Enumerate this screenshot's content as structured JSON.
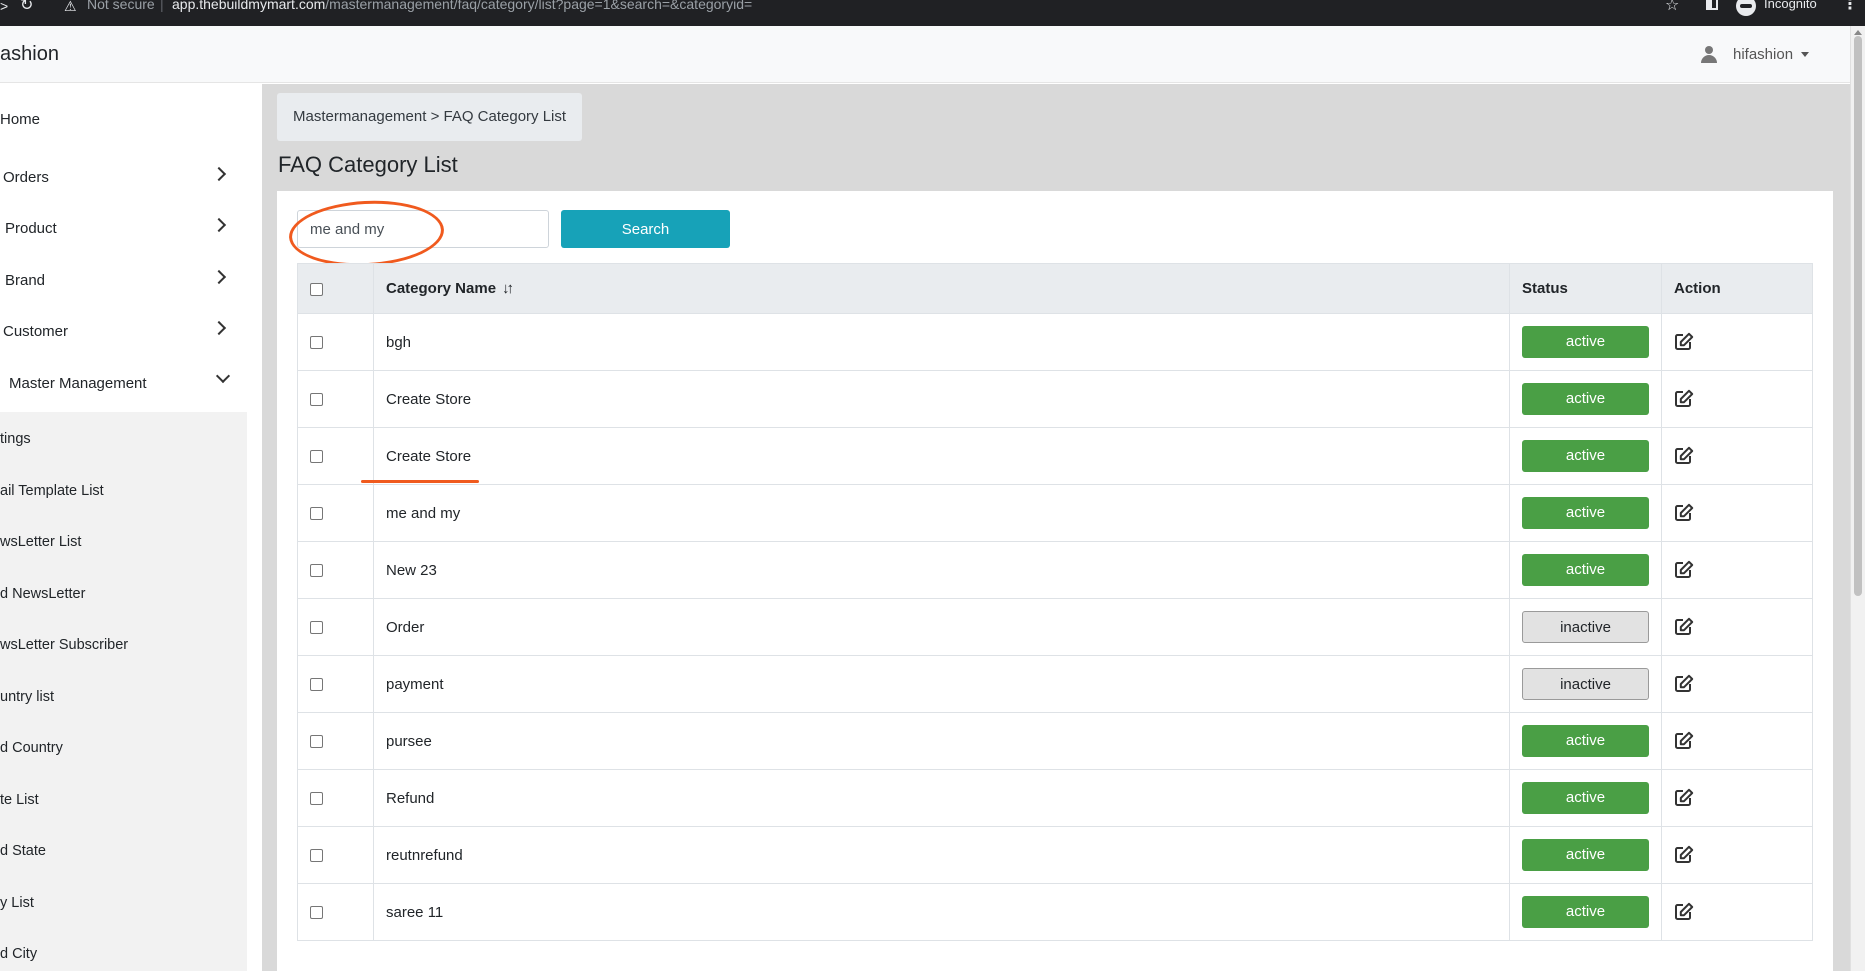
{
  "browser": {
    "not_secure": "Not secure",
    "url_host": "app.thebuildmymart.com",
    "url_path": "/mastermanagement/faq/category/list?page=1&search=&categoryid=",
    "incognito": "Incognito"
  },
  "navbar": {
    "brand": "ashion",
    "username": "hifashion"
  },
  "sidebar": {
    "items": [
      {
        "label": "Home"
      },
      {
        "label": "Orders"
      },
      {
        "label": "Product"
      },
      {
        "label": "Brand"
      },
      {
        "label": "Customer"
      },
      {
        "label": "Master Management"
      }
    ],
    "submenu": [
      {
        "label": "tings"
      },
      {
        "label": "ail Template List"
      },
      {
        "label": "wsLetter List"
      },
      {
        "label": "d NewsLetter"
      },
      {
        "label": "wsLetter Subscriber"
      },
      {
        "label": "untry list"
      },
      {
        "label": "d Country"
      },
      {
        "label": "te List"
      },
      {
        "label": "d State"
      },
      {
        "label": "y List"
      },
      {
        "label": "d City"
      }
    ]
  },
  "breadcrumb": "Mastermanagement > FAQ Category List",
  "page_title": "FAQ Category List",
  "search": {
    "value": "me and my",
    "button_label": "Search"
  },
  "table": {
    "headers": {
      "name": "Category Name",
      "sort_icon": "↓↑",
      "status": "Status",
      "action": "Action"
    },
    "rows": [
      {
        "name": "bgh",
        "status": "active"
      },
      {
        "name": "Create Store",
        "status": "active"
      },
      {
        "name": "Create Store",
        "status": "active"
      },
      {
        "name": "me and my",
        "status": "active"
      },
      {
        "name": "New 23",
        "status": "active"
      },
      {
        "name": "Order",
        "status": "inactive"
      },
      {
        "name": "payment",
        "status": "inactive"
      },
      {
        "name": "pursee",
        "status": "active"
      },
      {
        "name": "Refund",
        "status": "active"
      },
      {
        "name": "reutnrefund",
        "status": "active"
      },
      {
        "name": "saree 11",
        "status": "active"
      }
    ]
  },
  "colors": {
    "active": "#4a9f45",
    "search_button": "#17a2b8",
    "annotation": "#f05a1e"
  }
}
